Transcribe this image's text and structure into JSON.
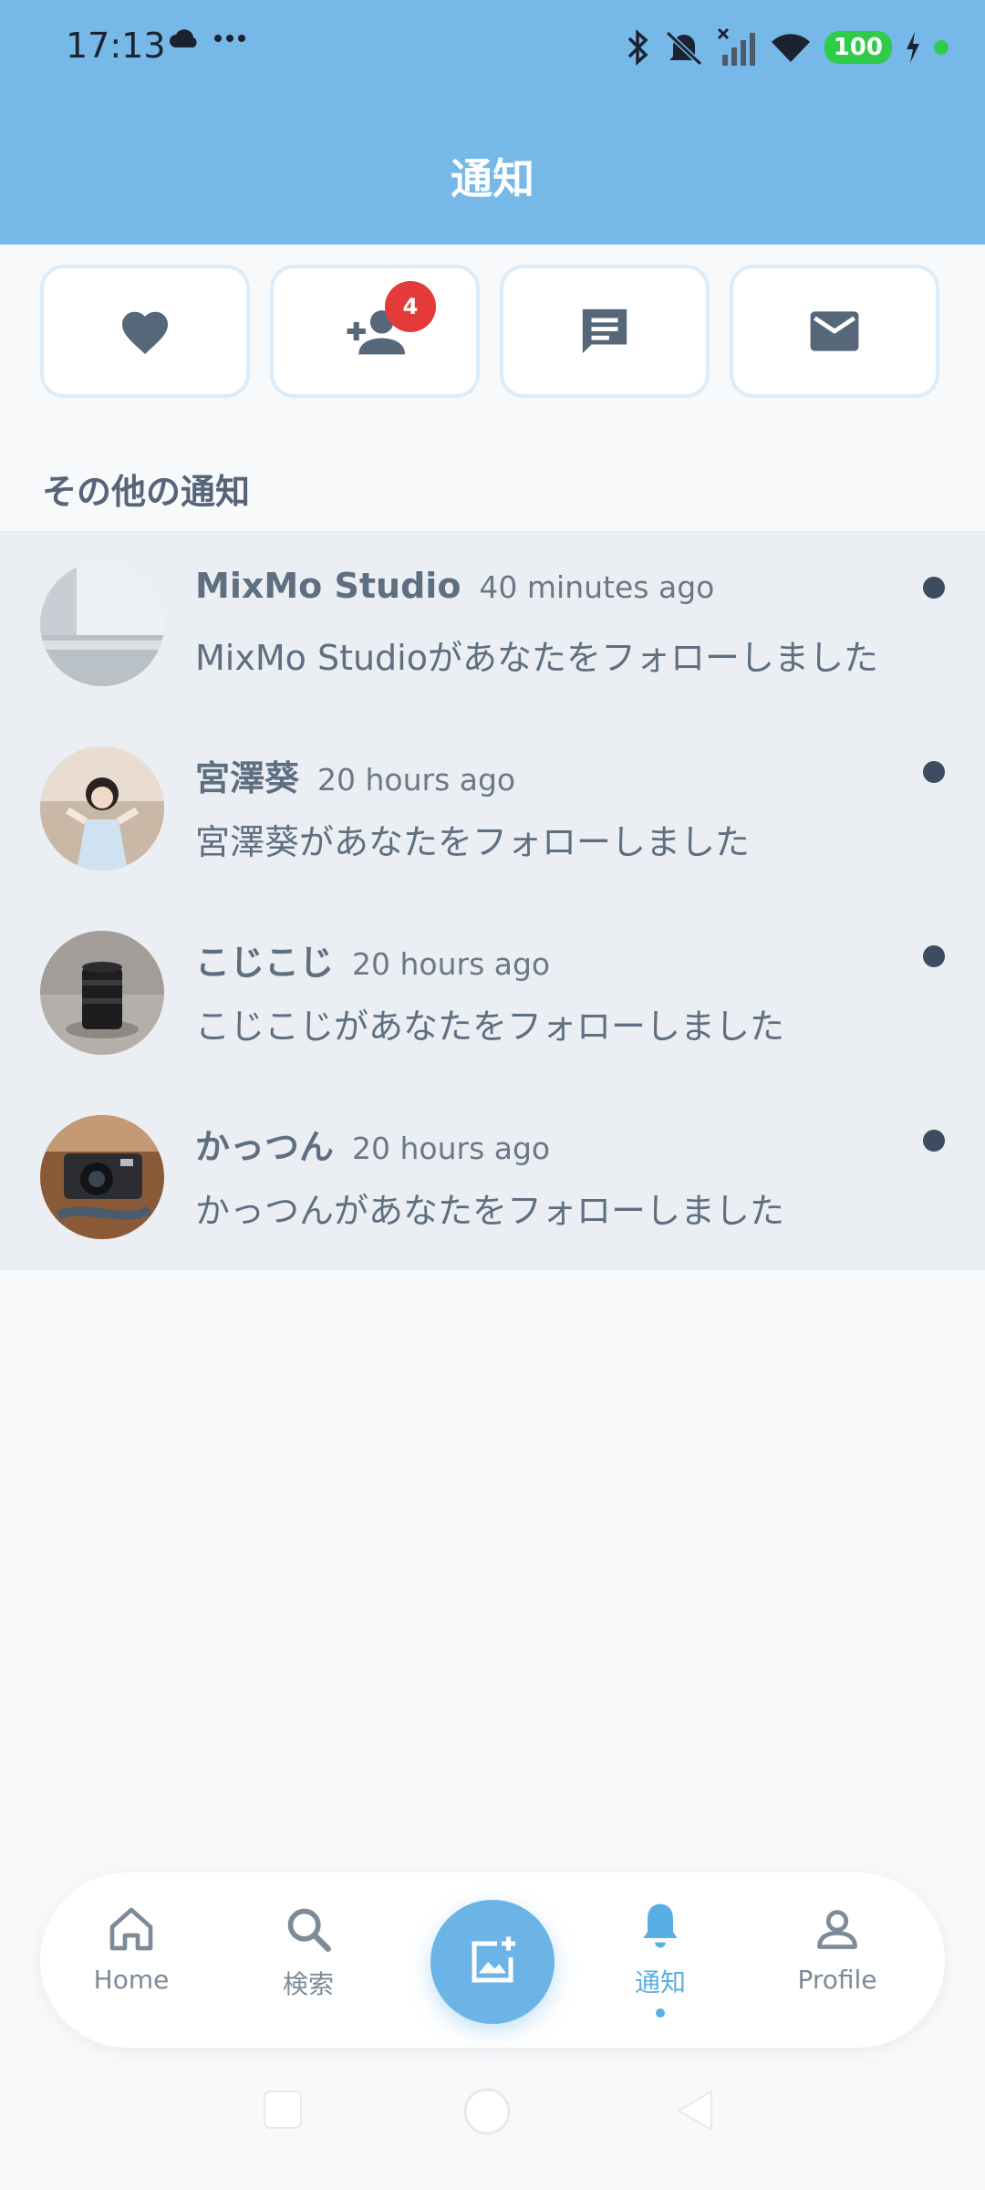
{
  "status_bar": {
    "time": "17:13",
    "battery": "100"
  },
  "header": {
    "title": "通知"
  },
  "filters": [
    {
      "icon": "heart-icon"
    },
    {
      "icon": "person-add-icon",
      "badge": "4"
    },
    {
      "icon": "chat-icon"
    },
    {
      "icon": "mail-icon"
    }
  ],
  "section": {
    "title": "その他の通知"
  },
  "notifications": [
    {
      "name": "MixMo Studio",
      "time": "40 minutes ago",
      "text": "MixMo Studioがあなたをフォローしました",
      "unread": true
    },
    {
      "name": "宮澤葵",
      "time": "20 hours ago",
      "text": "宮澤葵があなたをフォローしました",
      "unread": true
    },
    {
      "name": "こじこじ",
      "time": "20 hours ago",
      "text": "こじこじがあなたをフォローしました",
      "unread": true
    },
    {
      "name": "かっつん",
      "time": "20 hours ago",
      "text": "かっつんがあなたをフォローしました",
      "unread": true
    }
  ],
  "bottom_nav": {
    "home": "Home",
    "search": "検索",
    "notifications": "通知",
    "profile": "Profile",
    "active": "notifications"
  },
  "colors": {
    "header": "#76b8e8",
    "accent": "#5aaee6",
    "badge": "#e53a3a",
    "battery": "#2fcc4a"
  }
}
